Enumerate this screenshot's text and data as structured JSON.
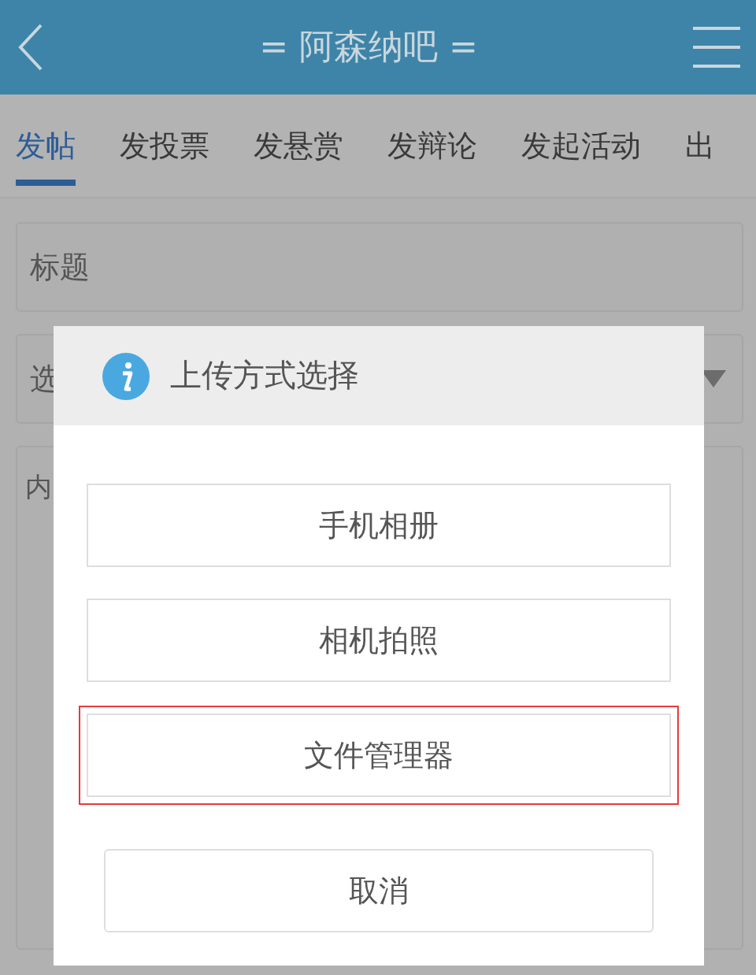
{
  "header": {
    "title": "= 阿森纳吧 ="
  },
  "tabs": [
    {
      "label": "发帖",
      "selected": true
    },
    {
      "label": "发投票",
      "selected": false
    },
    {
      "label": "发悬赏",
      "selected": false
    },
    {
      "label": "发辩论",
      "selected": false
    },
    {
      "label": "发起活动",
      "selected": false
    },
    {
      "label": "出",
      "selected": false
    }
  ],
  "form": {
    "fields": [
      {
        "kind": "text",
        "placeholder": "标题"
      },
      {
        "kind": "select",
        "value": "选"
      },
      {
        "kind": "textarea",
        "placeholder": "内"
      }
    ]
  },
  "dialog": {
    "title": "上传方式选择",
    "options": [
      {
        "label": "手机相册",
        "highlighted": false
      },
      {
        "label": "相机拍照",
        "highlighted": false
      },
      {
        "label": "文件管理器",
        "highlighted": true
      }
    ],
    "cancel": "取消"
  }
}
